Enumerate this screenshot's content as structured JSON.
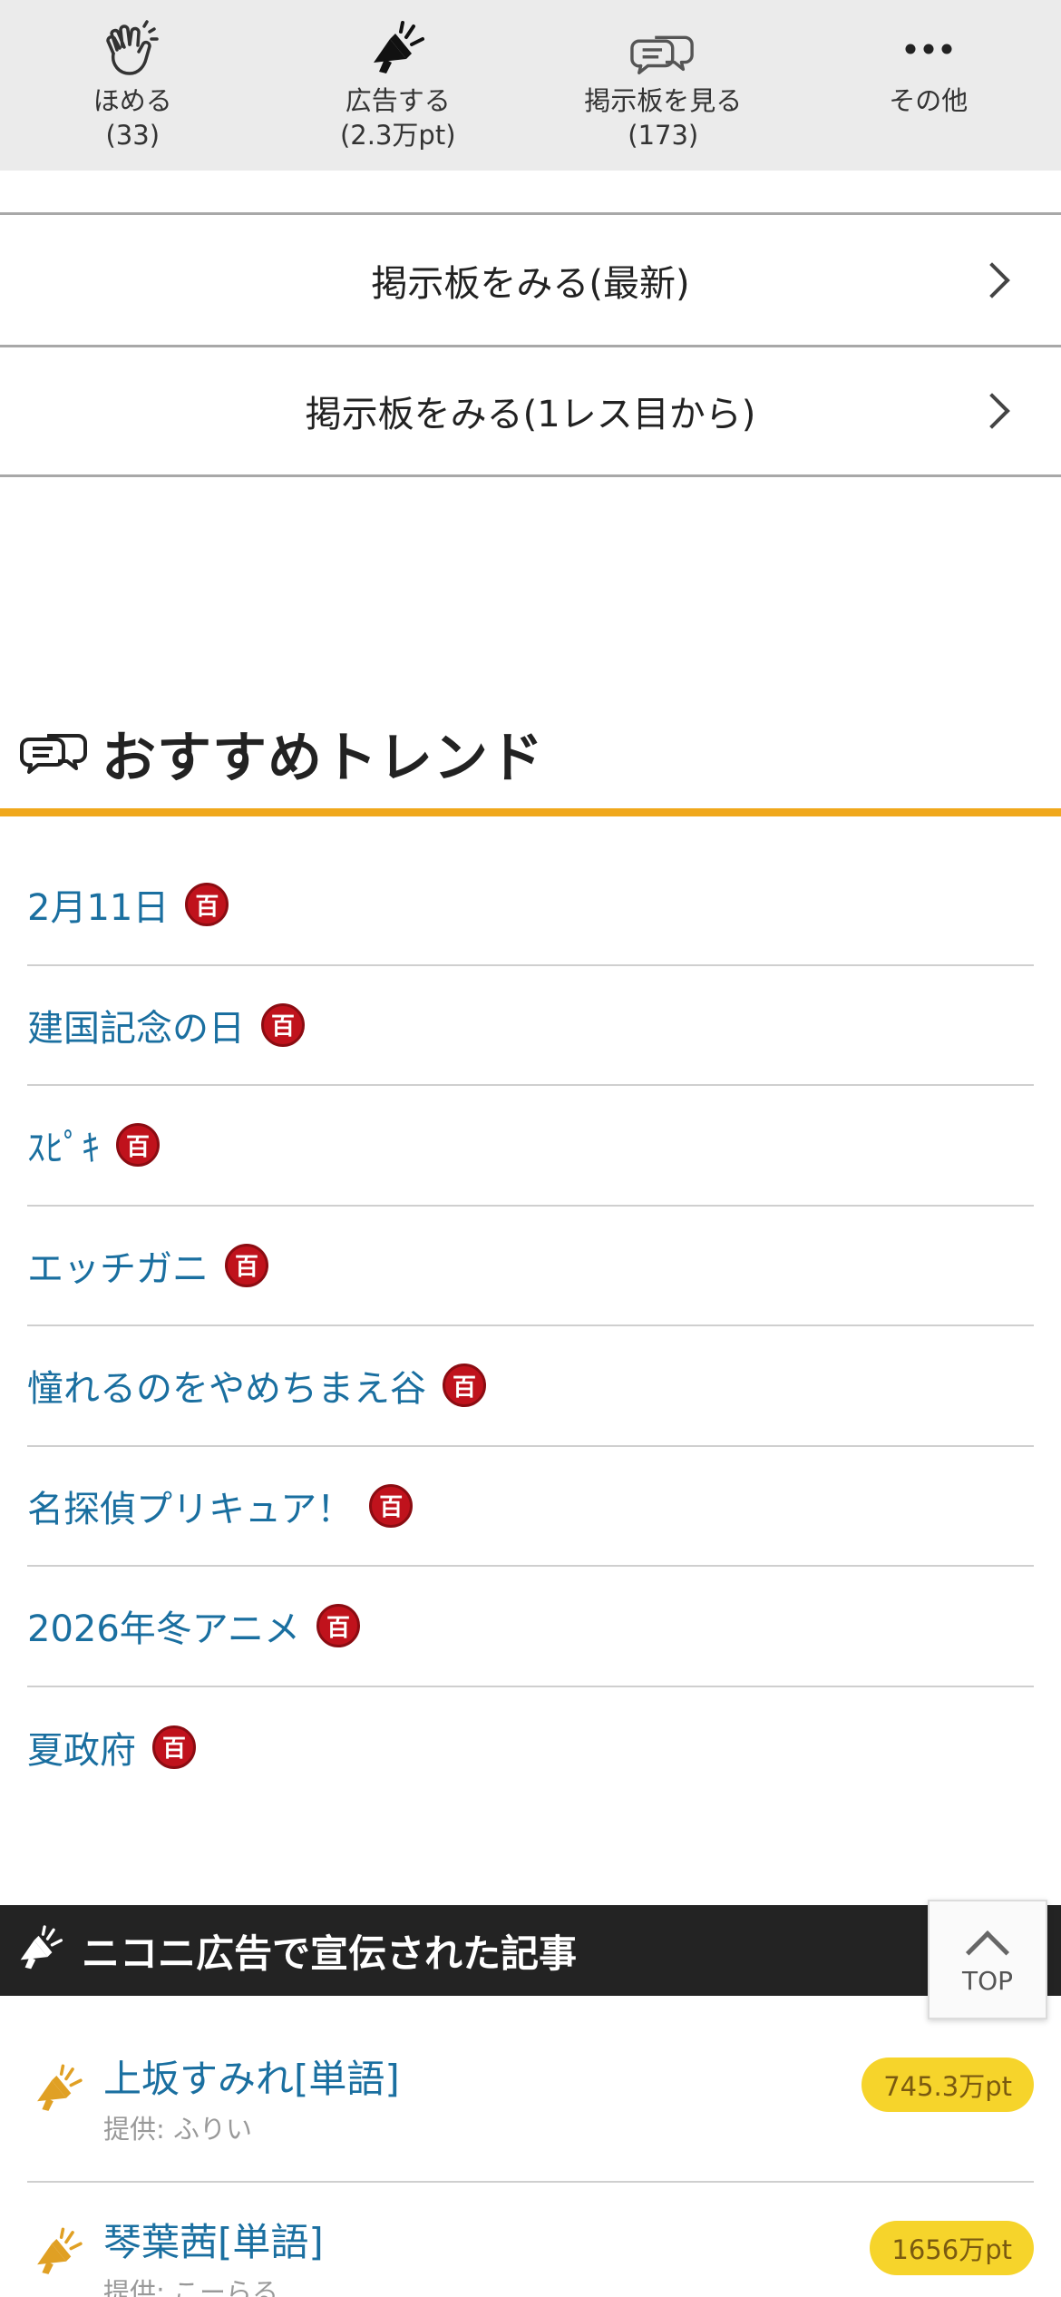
{
  "action_bar": {
    "items": [
      {
        "label": "ほめる",
        "count": "(33)",
        "icon": "clap-hands-icon"
      },
      {
        "label": "広告する",
        "count": "(2.3万pt)",
        "icon": "megaphone-icon"
      },
      {
        "label": "掲示板を見る",
        "count": "(173)",
        "icon": "chat-bubbles-icon"
      },
      {
        "label": "その他",
        "count": "",
        "icon": "more-dots-icon"
      }
    ]
  },
  "bbs_links": {
    "latest": "掲示板をみる(最新)",
    "from_first": "掲示板をみる(1レス目から)"
  },
  "trend": {
    "title": "おすすめトレンド",
    "badge": "百",
    "items": [
      "2月11日",
      "建国記念の日",
      "ｽﾋﾟｷ",
      "エッチガニ",
      "憧れるのをやめちまえ谷",
      "名探偵プリキュア！",
      "2026年冬アニメ",
      "夏政府"
    ]
  },
  "ads": {
    "title": "ニコニ広告で宣伝された記事",
    "items": [
      {
        "name": "上坂すみれ[単語]",
        "provider": "提供: ふりい",
        "points": "745.3万pt"
      },
      {
        "name": "琴葉茜[単語]",
        "provider": "提供: こーらる",
        "points": "1656万pt"
      }
    ]
  },
  "top_button": {
    "label": "TOP"
  },
  "colors": {
    "accent": "#f0a81c",
    "link": "#1a6fa0",
    "badge": "#c0121c",
    "ad_header": "#232323",
    "points_pill": "#f6d42b",
    "megaphone": "#e0a024"
  }
}
